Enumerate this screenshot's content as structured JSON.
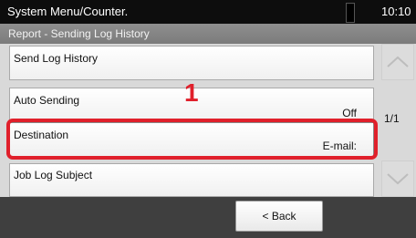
{
  "status_bar": {
    "title": "System Menu/Counter.",
    "time": "10:10"
  },
  "header": {
    "title": "Report - Sending Log History"
  },
  "list": {
    "items": [
      {
        "label": "Send Log History",
        "value": ""
      },
      {
        "label": "Auto Sending",
        "value": "Off"
      },
      {
        "label": "Destination",
        "value": "E-mail:"
      },
      {
        "label": "Job Log Subject",
        "value": ""
      }
    ]
  },
  "pagination": {
    "indicator": "1/1"
  },
  "callout": {
    "number": "1",
    "color": "#e0202b"
  },
  "footer": {
    "back_label": "< Back"
  },
  "icons": {
    "scroll_up": "chevron-up-icon",
    "scroll_down": "chevron-down-icon"
  }
}
